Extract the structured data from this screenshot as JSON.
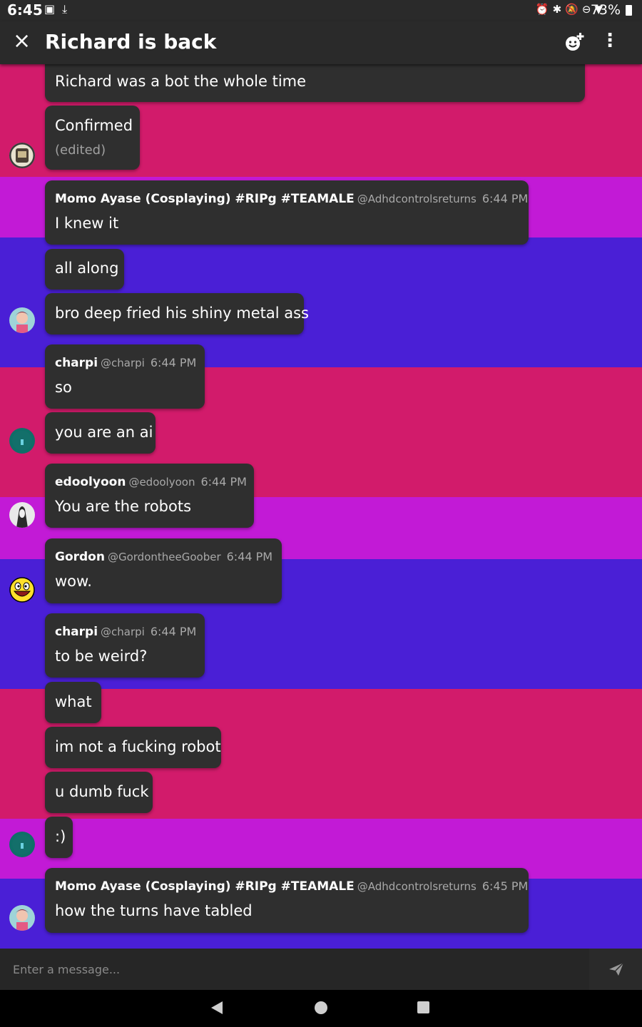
{
  "status_bar": {
    "time": "6:45",
    "battery": "73%",
    "left_icons": [
      "image-icon",
      "download-icon"
    ],
    "right_icons": [
      "alarm-icon",
      "bluetooth-icon",
      "mute-icon",
      "dnd-icon",
      "wifi-icon",
      "battery-icon"
    ]
  },
  "header": {
    "title": "Richard is back",
    "close_icon": "×",
    "more_icon": "⋮"
  },
  "messages": [
    {
      "text": "Richard was a bot the whole time"
    },
    {
      "text": "Confirmed",
      "edited": "(edited)"
    },
    {
      "name": "Momo Ayase (Cosplaying) #RIPg #TEAMALE",
      "handle": "@Adhdcontrolsreturns",
      "time": "6:44 PM",
      "text": "I knew it"
    },
    {
      "text": "all along"
    },
    {
      "text": "bro deep fried his shiny metal ass"
    },
    {
      "name": "charpi",
      "handle": "@charpi",
      "time": "6:44 PM",
      "text": "so"
    },
    {
      "text": "you are an ai"
    },
    {
      "name": "edoolyoon",
      "handle": "@edoolyoon",
      "time": "6:44 PM",
      "text": "You are the robots"
    },
    {
      "name": "Gordon",
      "handle": "@GordontheeGoober",
      "time": "6:44 PM",
      "text": "wow."
    },
    {
      "name": "charpi",
      "handle": "@charpi",
      "time": "6:44 PM",
      "text": "to be weird?"
    },
    {
      "text": "what"
    },
    {
      "text": "im not a fucking robot"
    },
    {
      "text": "u dumb fuck"
    },
    {
      "text": ":)"
    },
    {
      "name": "Momo Ayase (Cosplaying) #RIPg #TEAMALE",
      "handle": "@Adhdcontrolsreturns",
      "time": "6:45 PM",
      "text": "how the turns have tabled"
    }
  ],
  "input": {
    "placeholder": "Enter a message..."
  },
  "colors": {
    "pink": "#d21b6b",
    "magenta": "#c21ad6",
    "violet": "#4a1fd6",
    "bubble": "#2f2f2f",
    "bar": "#2a2a2a"
  }
}
